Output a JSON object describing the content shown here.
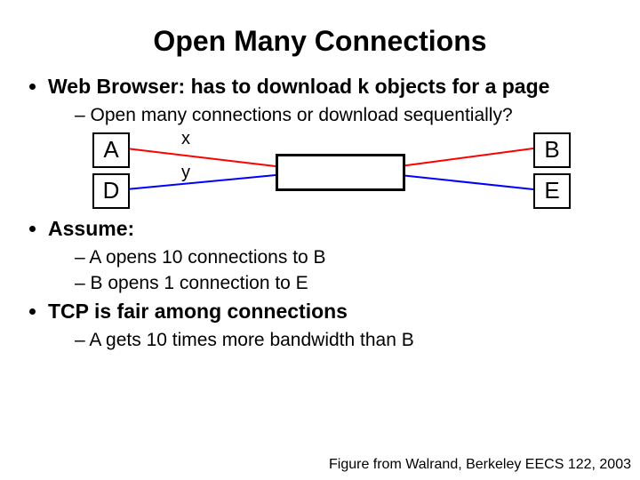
{
  "title": "Open Many Connections",
  "b1": "Web Browser: has to download k objects for a page",
  "b1s1": "Open many connections or download sequentially?",
  "b2": "Assume:",
  "b2s1": "A opens 10 connections to B",
  "b2s2": "B opens 1 connection to E",
  "b3": "TCP is fair among connections",
  "b3s1": "A gets 10 times more bandwidth than B",
  "credit": "Figure from Walrand, Berkeley EECS 122, 2003",
  "diagram": {
    "nodeA": "A",
    "nodeD": "D",
    "nodeB": "B",
    "nodeE": "E",
    "labelX": "x",
    "labelY": "y",
    "colors": {
      "flow1": "#ff0000",
      "flow2": "#0000ff"
    }
  }
}
